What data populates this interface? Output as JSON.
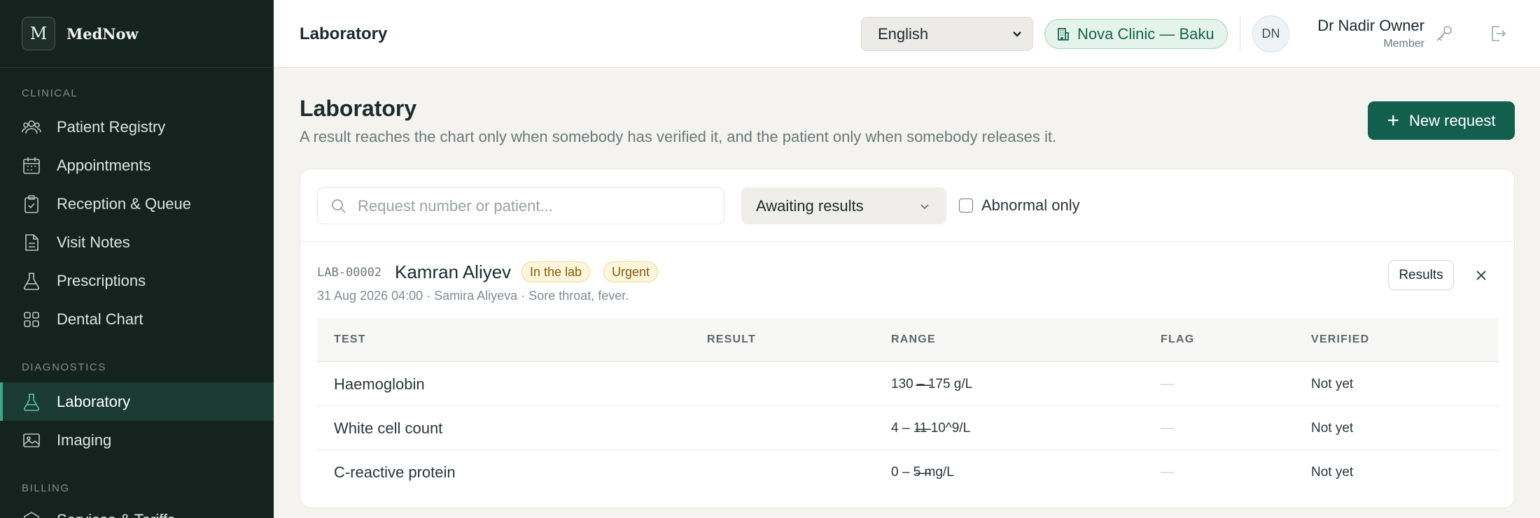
{
  "brand": {
    "logo_letter": "M",
    "name": "MedNow"
  },
  "sidebar": {
    "sections": [
      {
        "label": "CLINICAL"
      },
      {
        "label": "DIAGNOSTICS"
      },
      {
        "label": "BILLING"
      }
    ],
    "items": [
      {
        "label": "Patient Registry",
        "icon": "users-icon"
      },
      {
        "label": "Appointments",
        "icon": "calendar-icon"
      },
      {
        "label": "Reception & Queue",
        "icon": "clipboard-icon"
      },
      {
        "label": "Visit Notes",
        "icon": "document-icon"
      },
      {
        "label": "Prescriptions",
        "icon": "flask-icon"
      },
      {
        "label": "Dental Chart",
        "icon": "grid-icon"
      },
      {
        "label": "Laboratory",
        "icon": "flask-icon",
        "active": true
      },
      {
        "label": "Imaging",
        "icon": "image-icon"
      },
      {
        "label": "Services & Tariffs",
        "icon": "tag-icon"
      }
    ]
  },
  "topbar": {
    "title": "Laboratory",
    "language": "English",
    "clinic": "Nova Clinic — Baku",
    "user": {
      "initials": "DN",
      "name": "Dr Nadir Owner",
      "role": "Member"
    }
  },
  "page": {
    "title": "Laboratory",
    "subtitle": "A result reaches the chart only when somebody has verified it, and the patient only when somebody releases it.",
    "new_button": "New request"
  },
  "filters": {
    "search_placeholder": "Request number or patient...",
    "status": "Awaiting results",
    "abnormal_label": "Abnormal only"
  },
  "request": {
    "id": "LAB-00002",
    "patient": "Kamran Aliyev",
    "badges": [
      "In the lab",
      "Urgent"
    ],
    "meta": "31 Aug 2026 04:00 · Samira Aliyeva · Sore throat, fever.",
    "results_button": "Results"
  },
  "table": {
    "headers": [
      "TEST",
      "RESULT",
      "RANGE",
      "FLAG",
      "VERIFIED"
    ],
    "rows": [
      {
        "test": "Haemoglobin",
        "result": "—",
        "range": "130 – 175 g/L",
        "flag": "—",
        "verified": "Not yet"
      },
      {
        "test": "White cell count",
        "result": "—",
        "range": "4 – 11 10^9/L",
        "flag": "—",
        "verified": "Not yet"
      },
      {
        "test": "C-reactive protein",
        "result": "—",
        "range": "0 – 5 mg/L",
        "flag": "—",
        "verified": "Not yet"
      }
    ]
  },
  "colors": {
    "sidebar_bg": "#15231f",
    "accent": "#135f4d",
    "active_indicator": "#3fa585",
    "badge_bg": "#fdf5dc"
  }
}
